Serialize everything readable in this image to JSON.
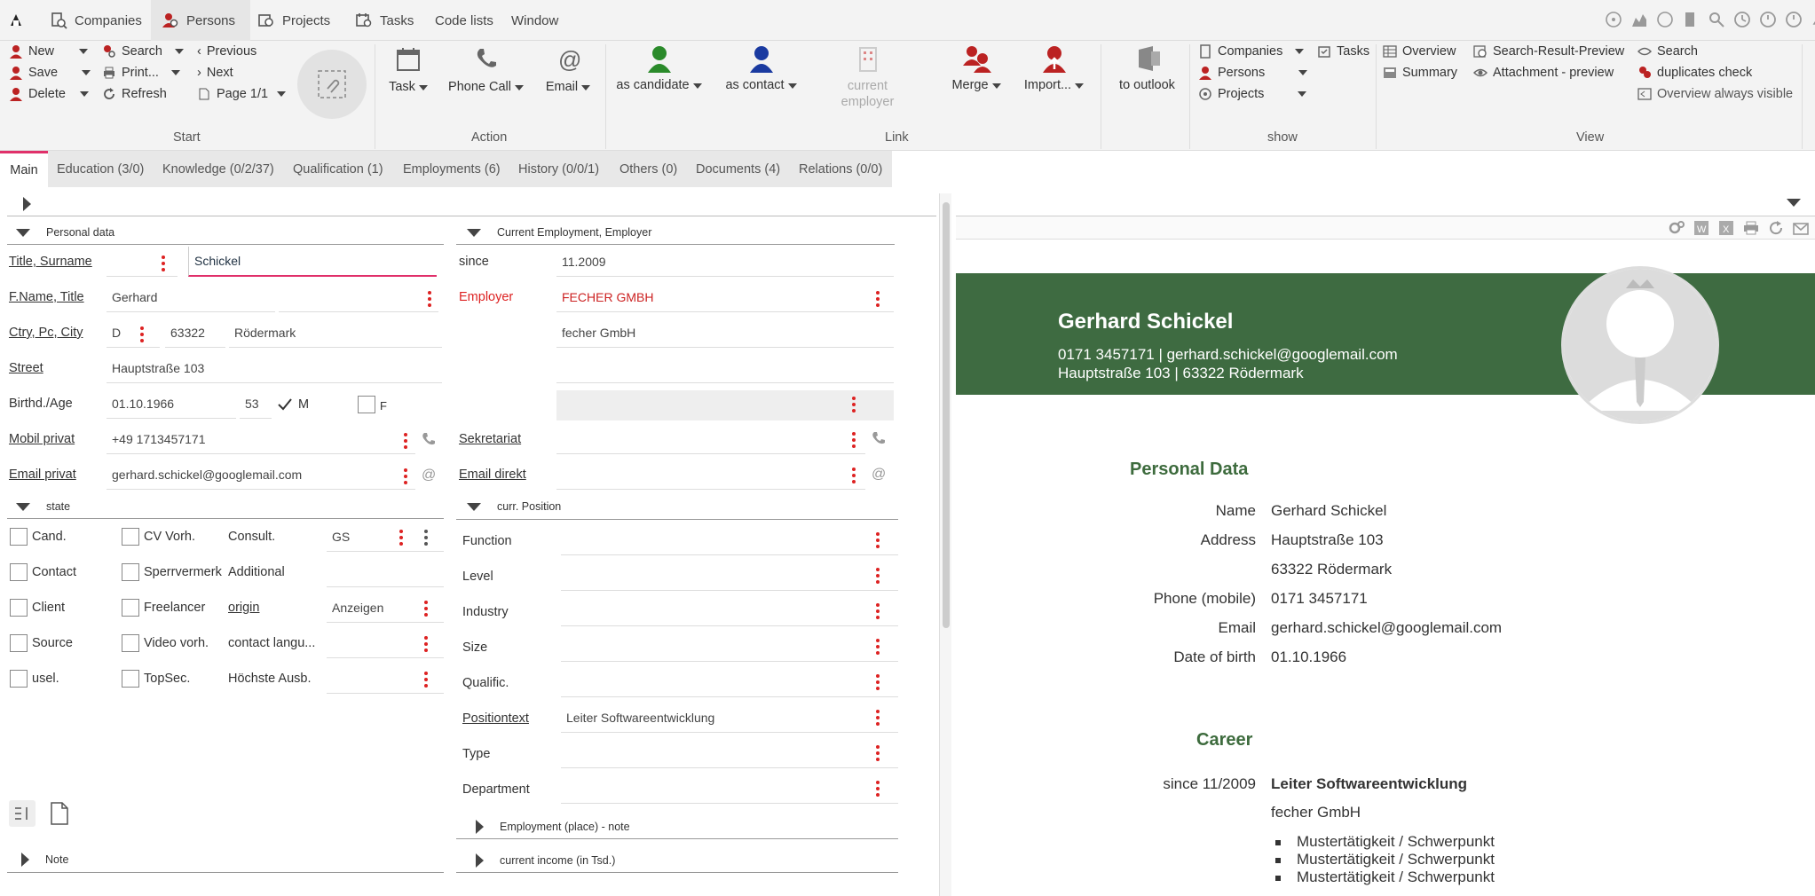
{
  "topnav": {
    "items": [
      {
        "label": "Companies",
        "icon": "building-search-icon"
      },
      {
        "label": "Persons",
        "icon": "person-search-icon"
      },
      {
        "label": "Projects",
        "icon": "projects-icon"
      },
      {
        "label": "Tasks",
        "icon": "tasks-icon"
      },
      {
        "label": "Code lists"
      },
      {
        "label": "Window"
      }
    ]
  },
  "ribbon": {
    "start": {
      "new": "New",
      "save": "Save",
      "delete": "Delete",
      "search": "Search",
      "print": "Print...",
      "refresh": "Refresh",
      "previous": "Previous",
      "next": "Next",
      "page": "Page 1/1",
      "label": "Start"
    },
    "action": {
      "task": "Task",
      "phone": "Phone Call",
      "email": "Email",
      "label": "Action"
    },
    "link": {
      "candidate": "as candidate",
      "contact": "as contact",
      "employer_line1": "current",
      "employer_line2": "employer",
      "merge": "Merge",
      "import": "Import...",
      "outlook": "to outlook",
      "label": "Link"
    },
    "show": {
      "companies": "Companies",
      "persons": "Persons",
      "projects": "Projects",
      "tasks": "Tasks",
      "label": "show"
    },
    "view": {
      "overview": "Overview",
      "summary": "Summary",
      "srp": "Search-Result-Preview",
      "attach": "Attachment - preview",
      "search": "Search",
      "dup": "duplicates check",
      "always": "Overview always visible",
      "label": "View"
    }
  },
  "tabs": [
    "Main",
    "Education (3/0)",
    "Knowledge (0/2/37)",
    "Qualification (1)",
    "Employments (6)",
    "History (0/0/1)",
    "Others (0)",
    "Documents (4)",
    "Relations (0/0)"
  ],
  "personal": {
    "header": "Personal data",
    "title_surname_label": "Title, Surname",
    "surname": "Schickel",
    "fname_title_label": "F.Name, Title",
    "fname": "Gerhard",
    "ctry_label": "Ctry, Pc, City",
    "country": "D",
    "pc": "63322",
    "city": "Rödermark",
    "street_label": "Street",
    "street": "Hauptstraße 103",
    "birth_label": "Birthd./Age",
    "birthdate": "01.10.1966",
    "age": "53",
    "male": "M",
    "female": "F",
    "mobil_label": "Mobil privat",
    "mobil": "+49 1713457171",
    "email_label": "Email privat",
    "email": "gerhard.schickel@googlemail.com"
  },
  "employment": {
    "header": "Current Employment, Employer",
    "since_label": "since",
    "since": "11.2009",
    "employer_label": "Employer",
    "employer": "FECHER GMBH",
    "employer2": "fecher GmbH",
    "sekretariat_label": "Sekretariat",
    "email_direkt_label": "Email direkt"
  },
  "state": {
    "header": "state",
    "rows": [
      {
        "c1": "Cand.",
        "c2": "CV Vorh.",
        "c3": "Consult.",
        "v": "GS"
      },
      {
        "c1": "Contact",
        "c2": "Sperrvermerk",
        "c3": "Additional",
        "v": ""
      },
      {
        "c1": "Client",
        "c2": "Freelancer",
        "c3": "origin",
        "v": "Anzeigen"
      },
      {
        "c1": "Source",
        "c2": "Video vorh.",
        "c3": "contact langu...",
        "v": ""
      },
      {
        "c1": "usel.",
        "c2": "TopSec.",
        "c3": "Höchste Ausb.",
        "v": ""
      }
    ]
  },
  "position": {
    "header": "curr. Position",
    "rows": [
      {
        "label": "Function",
        "value": ""
      },
      {
        "label": "Level",
        "value": ""
      },
      {
        "label": "Industry",
        "value": ""
      },
      {
        "label": "Size",
        "value": ""
      },
      {
        "label": "Qualific.",
        "value": ""
      },
      {
        "label": "Positiontext",
        "value": "Leiter Softwareentwicklung"
      },
      {
        "label": "Type",
        "value": ""
      },
      {
        "label": "Department",
        "value": ""
      }
    ],
    "emp_note": "Employment (place) - note",
    "income": "current income (in Tsd.)"
  },
  "note_header": "Note",
  "cv": {
    "name": "Gerhard Schickel",
    "contact_line": "0171 3457171 | gerhard.schickel@googlemail.com",
    "address_line": "Hauptstraße 103 | 63322 Rödermark",
    "personal_header": "Personal Data",
    "rows": [
      {
        "k": "Name",
        "v": "Gerhard Schickel"
      },
      {
        "k": "Address",
        "v": "Hauptstraße 103"
      },
      {
        "k": "",
        "v": "63322 Rödermark"
      },
      {
        "k": "Phone (mobile)",
        "v": "0171 3457171"
      },
      {
        "k": "Email",
        "v": "gerhard.schickel@googlemail.com"
      },
      {
        "k": "Date of birth",
        "v": "01.10.1966"
      }
    ],
    "career_header": "Career",
    "career_since": "since 11/2009",
    "career_title": "Leiter Softwareentwicklung",
    "career_company": "fecher GmbH",
    "bullets": [
      "Mustertätigkeit / Schwerpunkt",
      "Mustertätigkeit / Schwerpunkt",
      "Mustertätigkeit / Schwerpunkt"
    ],
    "banner_color": "#3e6b41"
  }
}
